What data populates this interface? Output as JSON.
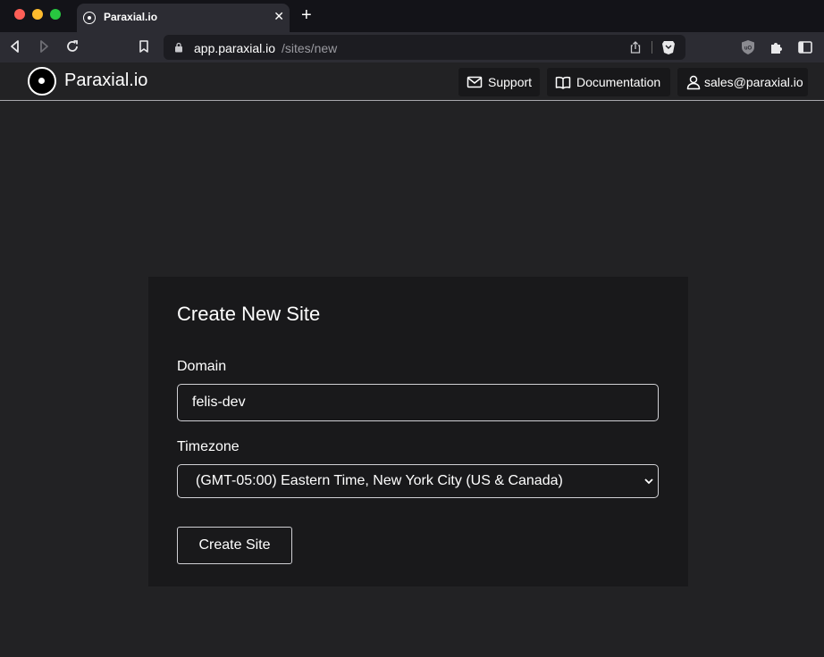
{
  "browser": {
    "tab_title": "Paraxial.io",
    "url_host": "app.paraxial.io",
    "url_path": "/sites/new"
  },
  "header": {
    "brand": "Paraxial.io",
    "support_label": "Support",
    "docs_label": "Documentation",
    "user_email": "sales@paraxial.io"
  },
  "form": {
    "title": "Create New Site",
    "domain_label": "Domain",
    "domain_value": "felis-dev",
    "timezone_label": "Timezone",
    "timezone_value": "(GMT-05:00) Eastern Time, New York City (US & Canada)",
    "submit_label": "Create Site"
  }
}
